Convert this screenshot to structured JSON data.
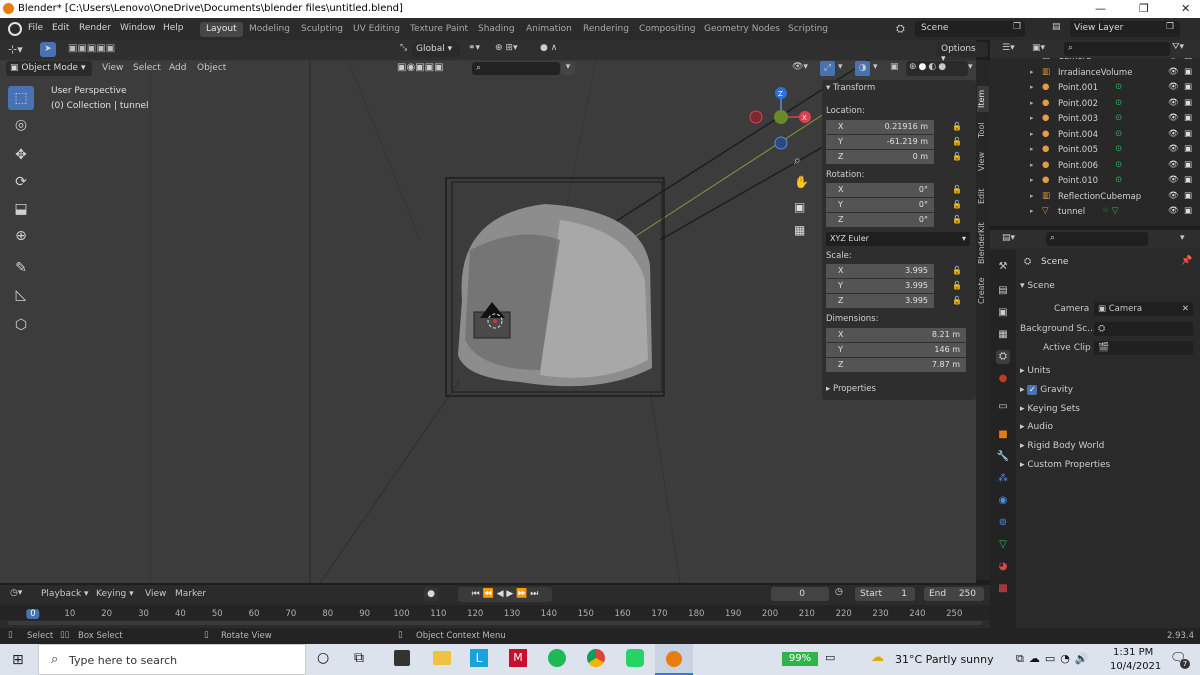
{
  "window": {
    "title": "Blender* [C:\\Users\\Lenovo\\OneDrive\\Documents\\blender files\\untitled.blend]"
  },
  "menu": [
    "File",
    "Edit",
    "Render",
    "Window",
    "Help"
  ],
  "workspaces": [
    "Layout",
    "Modeling",
    "Sculpting",
    "UV Editing",
    "Texture Paint",
    "Shading",
    "Animation",
    "Rendering",
    "Compositing",
    "Geometry Nodes",
    "Scripting"
  ],
  "active_workspace": "Layout",
  "scene_selector": "Scene",
  "view_layer": "View Layer",
  "viewport": {
    "mode": "Object Mode",
    "menus": [
      "View",
      "Select",
      "Add",
      "Object"
    ],
    "orientation": "Global",
    "options_label": "Options",
    "overlay_title": "User Perspective",
    "overlay_subtitle": "(0) Collection | tunnel"
  },
  "transform": {
    "header": "Transform",
    "location_label": "Location:",
    "location": {
      "x": "0.21916 m",
      "y": "-61.219 m",
      "z": "0 m"
    },
    "rotation_label": "Rotation:",
    "rotation": {
      "x": "0°",
      "y": "0°",
      "z": "0°"
    },
    "euler": "XYZ Euler",
    "scale_label": "Scale:",
    "scale": {
      "x": "3.995",
      "y": "3.995",
      "z": "3.995"
    },
    "dimensions_label": "Dimensions:",
    "dimensions": {
      "x": "8.21 m",
      "y": "146 m",
      "z": "7.87 m"
    },
    "properties_label": "Properties"
  },
  "side_tabs": [
    "Item",
    "Tool",
    "View",
    "Edit",
    "BlenderKit",
    "Create"
  ],
  "outliner": [
    {
      "name": "Camera",
      "type": "camera"
    },
    {
      "name": "IrradianceVolume",
      "type": "probe"
    },
    {
      "name": "Point.001",
      "type": "light"
    },
    {
      "name": "Point.002",
      "type": "light"
    },
    {
      "name": "Point.003",
      "type": "light"
    },
    {
      "name": "Point.004",
      "type": "light"
    },
    {
      "name": "Point.005",
      "type": "light"
    },
    {
      "name": "Point.006",
      "type": "light"
    },
    {
      "name": "Point.010",
      "type": "light"
    },
    {
      "name": "ReflectionCubemap",
      "type": "probe"
    },
    {
      "name": "tunnel",
      "type": "mesh"
    }
  ],
  "properties": {
    "breadcrumb": "Scene",
    "panel": "Scene",
    "camera_label": "Camera",
    "camera_value": "Camera",
    "background_label": "Background Sc...",
    "clip_label": "Active Clip",
    "sections": [
      "Units",
      "Gravity",
      "Keying Sets",
      "Audio",
      "Rigid Body World",
      "Custom Properties"
    ]
  },
  "timeline": {
    "menus": [
      "Playback",
      "Keying",
      "View",
      "Marker"
    ],
    "current_frame": "0",
    "start_label": "Start",
    "start": "1",
    "end_label": "End",
    "end": "250",
    "ticks": [
      "0",
      "10",
      "20",
      "30",
      "40",
      "50",
      "60",
      "70",
      "80",
      "90",
      "100",
      "110",
      "120",
      "130",
      "140",
      "150",
      "160",
      "170",
      "180",
      "190",
      "200",
      "210",
      "220",
      "230",
      "240",
      "250"
    ]
  },
  "statusbar": {
    "select": "Select",
    "box_select": "Box Select",
    "rotate": "Rotate View",
    "context": "Object Context Menu",
    "version": "2.93.4"
  },
  "taskbar": {
    "search_placeholder": "Type here to search",
    "battery": "99%",
    "weather": "31°C  Partly sunny",
    "time": "1:31 PM",
    "date": "10/4/2021",
    "notif": "7"
  }
}
